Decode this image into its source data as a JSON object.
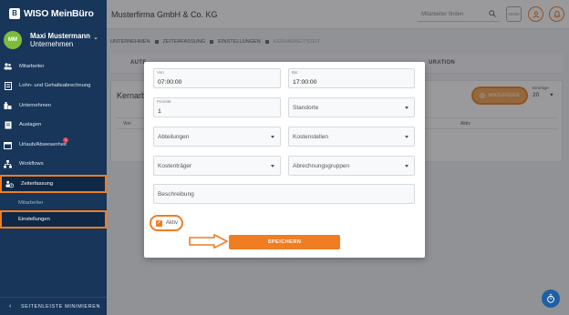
{
  "brand": {
    "logo_mark": "B",
    "name": "WISO MeinBüro"
  },
  "user": {
    "initials": "MM",
    "name": "Maxi Mustermann",
    "role": "Unternehmen"
  },
  "sidebar": {
    "items": [
      {
        "label": "Mitarbeiter",
        "icon": "people-icon"
      },
      {
        "label": "Lohn- und Gehaltsabrechnung",
        "icon": "payroll-icon"
      },
      {
        "label": "Unternehmen",
        "icon": "building-icon"
      },
      {
        "label": "Auslagen",
        "icon": "receipt-icon"
      },
      {
        "label": "Urlaub/Abwesenheit",
        "icon": "calendar-icon",
        "badge": "1"
      },
      {
        "label": "Workflows",
        "icon": "workflow-icon"
      },
      {
        "label": "Zeiterfassung",
        "icon": "clock-person-icon",
        "active": true
      }
    ],
    "subitems": [
      {
        "label": "Mitarbeiter"
      },
      {
        "label": "Einstellungen",
        "active": true
      }
    ],
    "collapse_label": "SEITENLEISTE MINIMIEREN"
  },
  "topbar": {
    "company": "Musterfirma GmbH & Co. KG",
    "search_placeholder": "Mitarbeiter finden",
    "btn_text": "sssss"
  },
  "breadcrumb": [
    "UNTERNEHMEN",
    "ZEITERFASSUNG",
    "EINSTELLUNGEN",
    "KERNARBEITSZEIT"
  ],
  "tabs": [
    "AUTE",
    "URATION"
  ],
  "card": {
    "title": "Kernarbe",
    "add_label": "HINZUFÜGEN",
    "entries_label": "Einträge",
    "entries_value": "20",
    "col_from": "Von",
    "col_active": "Aktiv"
  },
  "modal": {
    "from": {
      "label": "Von",
      "value": "07:00:00"
    },
    "to": {
      "label": "Bis",
      "value": "17:00:00"
    },
    "priority": {
      "label": "Priorität",
      "value": "1"
    },
    "locations": {
      "placeholder": "Standorte"
    },
    "departments": {
      "placeholder": "Abteilungen"
    },
    "cost_centers": {
      "placeholder": "Kostenstellen"
    },
    "cost_units": {
      "placeholder": "Kostenträger"
    },
    "billing_groups": {
      "placeholder": "Abrechnungsgruppen"
    },
    "description": {
      "placeholder": "Beschreibung"
    },
    "active": {
      "label": "Aktiv",
      "checked": true
    },
    "save_label": "SPEICHERN"
  },
  "colors": {
    "sidebar": "#17365a",
    "accent": "#ef7d22",
    "fab": "#1f5fa5"
  }
}
